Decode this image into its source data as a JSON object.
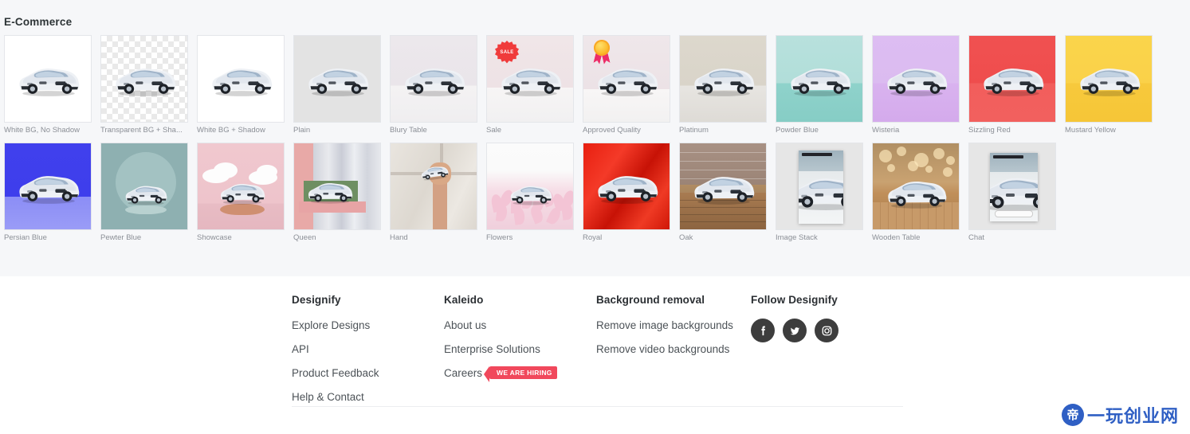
{
  "section": {
    "title": "E-Commerce"
  },
  "rows": [
    [
      {
        "label": "White BG, No Shadow",
        "bg": "bg-white",
        "variant": "plain-car",
        "badge": "none"
      },
      {
        "label": "Transparent BG + Sha...",
        "bg": "bg-checker",
        "variant": "plain-car",
        "badge": "none"
      },
      {
        "label": "White BG + Shadow",
        "bg": "bg-white",
        "variant": "plain-car",
        "badge": "none"
      },
      {
        "label": "Plain",
        "bg": "bg-plain",
        "variant": "plain-car",
        "badge": "none"
      },
      {
        "label": "Blury Table",
        "bg": "bg-blury",
        "variant": "plain-car",
        "badge": "none"
      },
      {
        "label": "Sale",
        "bg": "bg-sale",
        "variant": "plain-car",
        "badge": "sale"
      },
      {
        "label": "Approved Quality",
        "bg": "bg-approved",
        "variant": "plain-car",
        "badge": "medal"
      },
      {
        "label": "Platinum",
        "bg": "bg-platinum",
        "variant": "plain-car",
        "badge": "none"
      },
      {
        "label": "Powder Blue",
        "bg": "bg-powder",
        "variant": "plain-car",
        "badge": "none"
      },
      {
        "label": "Wisteria",
        "bg": "bg-wisteria",
        "variant": "plain-car",
        "badge": "none"
      },
      {
        "label": "Sizzling Red",
        "bg": "bg-red",
        "variant": "plain-car",
        "badge": "none"
      },
      {
        "label": "Mustard Yellow",
        "bg": "bg-mustard",
        "variant": "plain-car",
        "badge": "none"
      }
    ],
    [
      {
        "label": "Persian Blue",
        "bg": "bg-persian",
        "variant": "plain-car",
        "badge": "none"
      },
      {
        "label": "Pewter Blue",
        "bg": "bg-pewter",
        "variant": "pewter",
        "badge": "none"
      },
      {
        "label": "Showcase",
        "bg": "bg-showcase",
        "variant": "showcase",
        "badge": "none"
      },
      {
        "label": "Queen",
        "bg": "bg-queen",
        "variant": "queen",
        "badge": "none"
      },
      {
        "label": "Hand",
        "bg": "bg-hand",
        "variant": "hand",
        "badge": "none"
      },
      {
        "label": "Flowers",
        "bg": "bg-flowers",
        "variant": "flowers",
        "badge": "none"
      },
      {
        "label": "Royal",
        "bg": "bg-royal",
        "variant": "plain-car",
        "badge": "none"
      },
      {
        "label": "Oak",
        "bg": "bg-oak",
        "variant": "oak",
        "badge": "none"
      },
      {
        "label": "Image Stack",
        "bg": "bg-stack",
        "variant": "image-stack",
        "badge": "none"
      },
      {
        "label": "Wooden Table",
        "bg": "bg-wooden",
        "variant": "wooden",
        "badge": "none"
      },
      {
        "label": "Chat",
        "bg": "bg-chat",
        "variant": "chat",
        "badge": "none"
      }
    ]
  ],
  "badges": {
    "sale_text": "SALE"
  },
  "footer": {
    "columns": [
      {
        "title": "Designify",
        "links": [
          {
            "label": "Explore Designs"
          },
          {
            "label": "API"
          },
          {
            "label": "Product Feedback"
          },
          {
            "label": "Help & Contact"
          }
        ]
      },
      {
        "title": "Kaleido",
        "links": [
          {
            "label": "About us"
          },
          {
            "label": "Enterprise Solutions"
          },
          {
            "label": "Careers",
            "badge": "WE ARE HIRING"
          }
        ]
      },
      {
        "title": "Background removal",
        "links": [
          {
            "label": "Remove image backgrounds"
          },
          {
            "label": "Remove video backgrounds"
          }
        ]
      }
    ],
    "social": {
      "title": "Follow Designify",
      "icons": [
        "facebook-icon",
        "twitter-icon",
        "instagram-icon"
      ]
    }
  },
  "watermark": {
    "text": "一玩创业网",
    "logo_glyph": "帝",
    "color": "#2f5fc4"
  },
  "colors": {
    "page_bg": "#f6f7f9",
    "footer_bg": "#ffffff",
    "accent_red": "#f1485c",
    "sale_red": "#f03b3b",
    "title": "#2d3436",
    "label": "#8b8f96",
    "link": "#4c5257"
  }
}
